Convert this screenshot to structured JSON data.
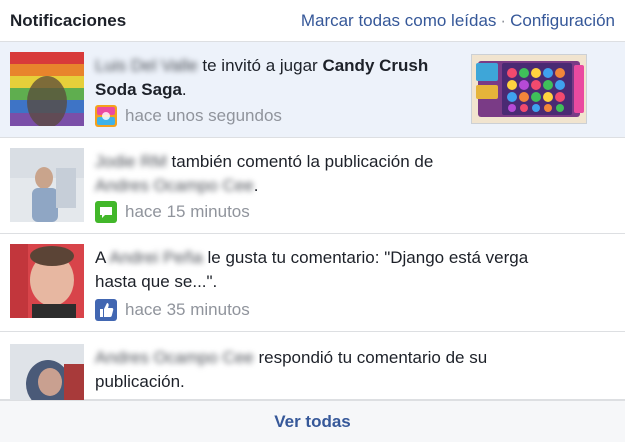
{
  "header": {
    "title": "Notificaciones",
    "mark_all_read": "Marcar todas como leídas",
    "separator": "·",
    "settings": "Configuración"
  },
  "notifications": [
    {
      "actor": "Luis Del Valle",
      "pre_text": "",
      "text": " te invitó a jugar ",
      "bold_text": "Candy Crush Soda Saga",
      "post_text": ".",
      "time": "hace unos segundos",
      "icon": "candy-crush-app-icon",
      "unread": true
    },
    {
      "actor": "Jodie RM",
      "text": " también comentó la publicación de ",
      "target": "Andres Ocampo Cee",
      "post_text": ".",
      "time": "hace 15 minutos",
      "icon": "comment-icon",
      "unread": false
    },
    {
      "pre_text": "A ",
      "actor": "Andrei Peña",
      "text": " le gusta tu comentario: \"Django está verga hasta que se...\".",
      "time": "hace 35 minutos",
      "icon": "like-icon",
      "unread": false
    },
    {
      "actor": "Andres Ocampo Cee",
      "text": " respondió tu comentario de su publicación.",
      "time": "",
      "icon": "comment-icon",
      "unread": false
    }
  ],
  "footer": {
    "see_all": "Ver todas"
  },
  "colors": {
    "link": "#365899",
    "unread_bg": "#edf2fa",
    "comment_icon": "#42b72a",
    "like_icon": "#4267b2"
  }
}
